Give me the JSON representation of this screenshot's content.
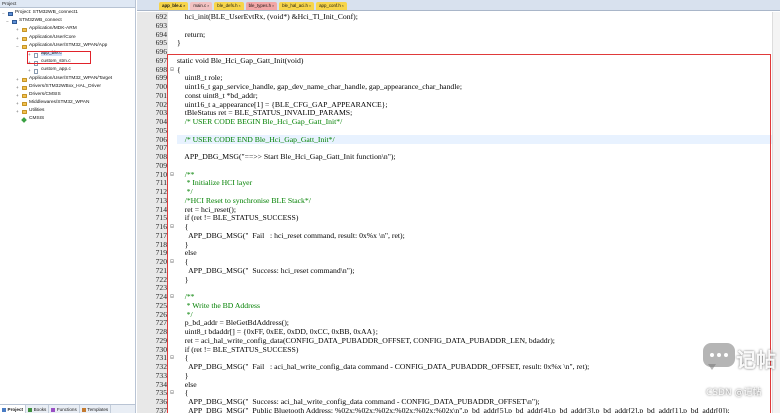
{
  "panel": {
    "title": "Project",
    "tree": [
      {
        "label": "Project: STM32WB_connect1",
        "kind": "proj",
        "exp": "−"
      },
      {
        "label": "STM32WB_connect",
        "kind": "proj",
        "exp": "−"
      },
      {
        "label": "Application/MDK-ARM",
        "kind": "folder",
        "exp": "+"
      },
      {
        "label": "Application/User/Core",
        "kind": "folder",
        "exp": "+"
      },
      {
        "label": "Application/User/STM32_WPAN/App",
        "kind": "folder",
        "exp": "−"
      },
      {
        "label": "app_ble.c",
        "kind": "file",
        "exp": "+"
      },
      {
        "label": "custom_stm.c",
        "kind": "file",
        "exp": "+"
      },
      {
        "label": "custom_app.c",
        "kind": "file",
        "exp": "+"
      },
      {
        "label": "Application/User/STM32_WPAN/Target",
        "kind": "folder",
        "exp": "+"
      },
      {
        "label": "Drivers/STM32WBxx_HAL_Driver",
        "kind": "folder",
        "exp": "+"
      },
      {
        "label": "Drivers/CMSIS",
        "kind": "folder",
        "exp": "+"
      },
      {
        "label": "Middlewares/STM32_WPAN",
        "kind": "folder",
        "exp": "+"
      },
      {
        "label": "Utilities",
        "kind": "folder",
        "exp": "+"
      },
      {
        "label": "CMSIS",
        "kind": "gem",
        "exp": ""
      }
    ],
    "tabs": [
      {
        "label": "Project",
        "color": "#4a7cc4"
      },
      {
        "label": "Books",
        "color": "#3f8f3f"
      },
      {
        "label": "Functions",
        "color": "#9a4fc4"
      },
      {
        "label": "Templates",
        "color": "#c47a2f"
      }
    ]
  },
  "editor": {
    "tabs": [
      {
        "label": "app_ble.c",
        "color": "#f7d54a"
      },
      {
        "label": "main.c",
        "color": "#f2c2c2"
      },
      {
        "label": "ble_defs.h",
        "color": "#f7d54a"
      },
      {
        "label": "ble_types.h",
        "color": "#f2a6a6"
      },
      {
        "label": "ble_hal_aci.h",
        "color": "#f7d54a"
      },
      {
        "label": "app_conf.h",
        "color": "#f7d54a"
      }
    ],
    "lines": [
      {
        "n": "692",
        "t": "    hci_init(BLE_UserEvtRx, (void*) &Hci_Tl_Init_Conf);",
        "fold": ""
      },
      {
        "n": "693",
        "t": "",
        "fold": ""
      },
      {
        "n": "694",
        "t": "    return;",
        "fold": ""
      },
      {
        "n": "695",
        "t": "}",
        "fold": ""
      },
      {
        "n": "696",
        "t": "",
        "fold": ""
      },
      {
        "n": "697",
        "t": "static void Ble_Hci_Gap_Gatt_Init(void)",
        "fold": ""
      },
      {
        "n": "698",
        "t": "{",
        "fold": "⊟"
      },
      {
        "n": "699",
        "t": "    uint8_t role;",
        "fold": ""
      },
      {
        "n": "700",
        "t": "    uint16_t gap_service_handle, gap_dev_name_char_handle, gap_appearance_char_handle;",
        "fold": ""
      },
      {
        "n": "701",
        "t": "    const uint8_t *bd_addr;",
        "fold": ""
      },
      {
        "n": "702",
        "t": "    uint16_t a_appearance[1] = {BLE_CFG_GAP_APPEARANCE};",
        "fold": ""
      },
      {
        "n": "703",
        "t": "    tBleStatus ret = BLE_STATUS_INVALID_PARAMS;",
        "fold": ""
      },
      {
        "n": "704",
        "t": "    /* USER CODE BEGIN Ble_Hci_Gap_Gatt_Init*/",
        "fold": "",
        "comment": true
      },
      {
        "n": "705",
        "t": "",
        "fold": ""
      },
      {
        "n": "706",
        "t": "    /* USER CODE END Ble_Hci_Gap_Gatt_Init*/",
        "fold": "",
        "comment": true,
        "hl": true
      },
      {
        "n": "707",
        "t": "",
        "fold": ""
      },
      {
        "n": "708",
        "t": "    APP_DBG_MSG(\"==>> Start Ble_Hci_Gap_Gatt_Init function\\n\");",
        "fold": ""
      },
      {
        "n": "709",
        "t": "",
        "fold": ""
      },
      {
        "n": "710",
        "t": "    /**",
        "fold": "⊟",
        "comment": true
      },
      {
        "n": "711",
        "t": "     * Initialize HCI layer",
        "fold": "",
        "comment": true
      },
      {
        "n": "712",
        "t": "     */",
        "fold": "",
        "comment": true
      },
      {
        "n": "713",
        "t": "    /*HCI Reset to synchronise BLE Stack*/",
        "fold": "",
        "comment": true
      },
      {
        "n": "714",
        "t": "    ret = hci_reset();",
        "fold": ""
      },
      {
        "n": "715",
        "t": "    if (ret != BLE_STATUS_SUCCESS)",
        "fold": ""
      },
      {
        "n": "716",
        "t": "    {",
        "fold": "⊟"
      },
      {
        "n": "717",
        "t": "      APP_DBG_MSG(\"  Fail   : hci_reset command, result: 0x%x \\n\", ret);",
        "fold": ""
      },
      {
        "n": "718",
        "t": "    }",
        "fold": ""
      },
      {
        "n": "719",
        "t": "    else",
        "fold": ""
      },
      {
        "n": "720",
        "t": "    {",
        "fold": "⊟"
      },
      {
        "n": "721",
        "t": "      APP_DBG_MSG(\"  Success: hci_reset command\\n\");",
        "fold": ""
      },
      {
        "n": "722",
        "t": "    }",
        "fold": ""
      },
      {
        "n": "723",
        "t": "",
        "fold": ""
      },
      {
        "n": "724",
        "t": "    /**",
        "fold": "⊟",
        "comment": true
      },
      {
        "n": "725",
        "t": "     * Write the BD Address",
        "fold": "",
        "comment": true
      },
      {
        "n": "726",
        "t": "     */",
        "fold": "",
        "comment": true
      },
      {
        "n": "727",
        "t": "    p_bd_addr = BleGetBdAddress();",
        "fold": ""
      },
      {
        "n": "728",
        "t": "    uint8_t bdaddr[] = {0xFF, 0xEE, 0xDD, 0xCC, 0xBB, 0xAA};",
        "fold": ""
      },
      {
        "n": "729",
        "t": "    ret = aci_hal_write_config_data(CONFIG_DATA_PUBADDR_OFFSET, CONFIG_DATA_PUBADDR_LEN, bdaddr);",
        "fold": ""
      },
      {
        "n": "730",
        "t": "    if (ret != BLE_STATUS_SUCCESS)",
        "fold": ""
      },
      {
        "n": "731",
        "t": "    {",
        "fold": "⊟"
      },
      {
        "n": "732",
        "t": "      APP_DBG_MSG(\"  Fail   : aci_hal_write_config_data command - CONFIG_DATA_PUBADDR_OFFSET, result: 0x%x \\n\", ret);",
        "fold": ""
      },
      {
        "n": "733",
        "t": "    }",
        "fold": ""
      },
      {
        "n": "734",
        "t": "    else",
        "fold": ""
      },
      {
        "n": "735",
        "t": "    {",
        "fold": "⊟"
      },
      {
        "n": "736",
        "t": "      APP_DBG_MSG(\"  Success: aci_hal_write_config_data command - CONFIG_DATA_PUBADDR_OFFSET\\n\");",
        "fold": ""
      },
      {
        "n": "737",
        "t": "      APP_DBG_MSG(\"  Public Bluetooth Address: %02x:%02x:%02x:%02x:%02x:%02x\\n\",p_bd_addr[5],p_bd_addr[4],p_bd_addr[3],p_bd_addr[2],p_bd_addr[1],p_bd_addr[0]);",
        "fold": ""
      }
    ]
  },
  "watermark": {
    "text": "记帖",
    "sub": "CSDN @记帖"
  },
  "colors": {
    "highlight_border": "#e0222a",
    "comment": "#008000",
    "gutter": "#e8e8e8"
  }
}
